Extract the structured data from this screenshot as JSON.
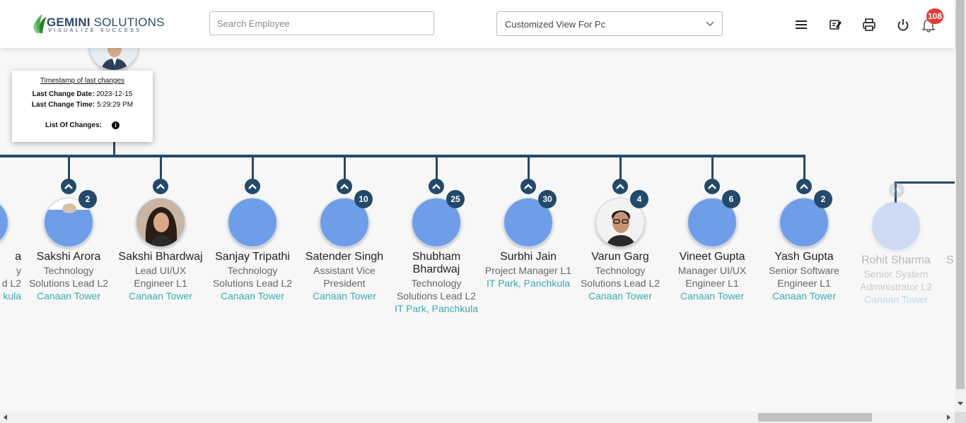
{
  "header": {
    "logo_name_bold": "GEMINI",
    "logo_name_rest": " SOLUTIONS",
    "logo_tagline": "VISUALIZE SUCCESS",
    "search_placeholder": "Search Employee",
    "view_selected": "Customized View For Pc",
    "notification_count": "108",
    "icons": [
      "menu-icon",
      "edit-notes-icon",
      "print-icon",
      "power-icon",
      "bell-icon"
    ]
  },
  "tooltip": {
    "title": "Timestamp of last changes",
    "date_label": "Last Change Date:",
    "date_value": "2023-12-15",
    "time_label": "Last Change Time:",
    "time_value": "5:29:29 PM",
    "changes_label": "List Of Changes:"
  },
  "partial_left": {
    "name": "a",
    "role": "y",
    "role2": "d L2",
    "location": "kula"
  },
  "employees": [
    {
      "name": "Sakshi Arora",
      "role": "Technology Solutions Lead L2",
      "location": "Canaan Tower",
      "count": "2",
      "photo": "partial"
    },
    {
      "name": "Sakshi Bhardwaj",
      "role": "Lead UI/UX Engineer L1",
      "location": "Canaan Tower",
      "count": "",
      "photo": "woman"
    },
    {
      "name": "Sanjay Tripathi",
      "role": "Technology Solutions Lead L2",
      "location": "Canaan Tower",
      "count": "",
      "photo": "none"
    },
    {
      "name": "Satender Singh",
      "role": "Assistant Vice President",
      "location": "Canaan Tower",
      "count": "10",
      "photo": "none"
    },
    {
      "name": "Shubham Bhardwaj",
      "role": "Technology Solutions Lead L2",
      "location": "IT Park, Panchkula",
      "count": "25",
      "photo": "none"
    },
    {
      "name": "Surbhi Jain",
      "role": "Project Manager L1",
      "location": "IT Park, Panchkula",
      "count": "30",
      "photo": "none"
    },
    {
      "name": "Varun Garg",
      "role": "Technology Solutions Lead L2",
      "location": "Canaan Tower",
      "count": "4",
      "photo": "man"
    },
    {
      "name": "Vineet Gupta",
      "role": "Manager UI/UX Engineer L1",
      "location": "Canaan Tower",
      "count": "6",
      "photo": "none"
    },
    {
      "name": "Yash Gupta",
      "role": "Senior Software Engineer L1",
      "location": "Canaan Tower",
      "count": "2",
      "photo": "none"
    }
  ],
  "faded_employee": {
    "name": "Rohit Sharma",
    "role": "Senior System Administrator L2",
    "location": "Canaan Tower"
  },
  "partial_right": {
    "name": "S"
  }
}
